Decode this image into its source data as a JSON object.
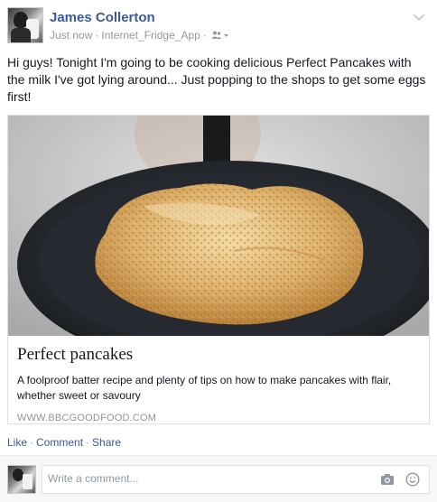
{
  "post": {
    "author": "James Collerton",
    "timestamp": "Just now",
    "separator": "·",
    "app_name": "Internet_Fridge_App",
    "audience_icon": "friends-icon",
    "options_icon": "chevron-down-icon",
    "text": "Hi guys! Tonight I'm going to be cooking delicious Perfect Pancakes with the milk I've got lying around... Just popping to the shops to get some eggs first!"
  },
  "link_card": {
    "image_icon": "pancake-in-pan-photo",
    "title": "Perfect pancakes",
    "description": "A foolproof batter recipe and plenty of tips on how to make pancakes with flair, whether sweet or savoury",
    "domain": "WWW.BBCGOODFOOD.COM"
  },
  "actions": {
    "like": "Like",
    "comment": "Comment",
    "share": "Share",
    "separator": "·"
  },
  "comment_box": {
    "placeholder": "Write a comment...",
    "camera_icon": "camera-icon",
    "emoji_icon": "smiley-icon"
  },
  "colors": {
    "link_blue": "#3b5998",
    "meta_grey": "#9197a3",
    "border": "#dddfe2"
  }
}
